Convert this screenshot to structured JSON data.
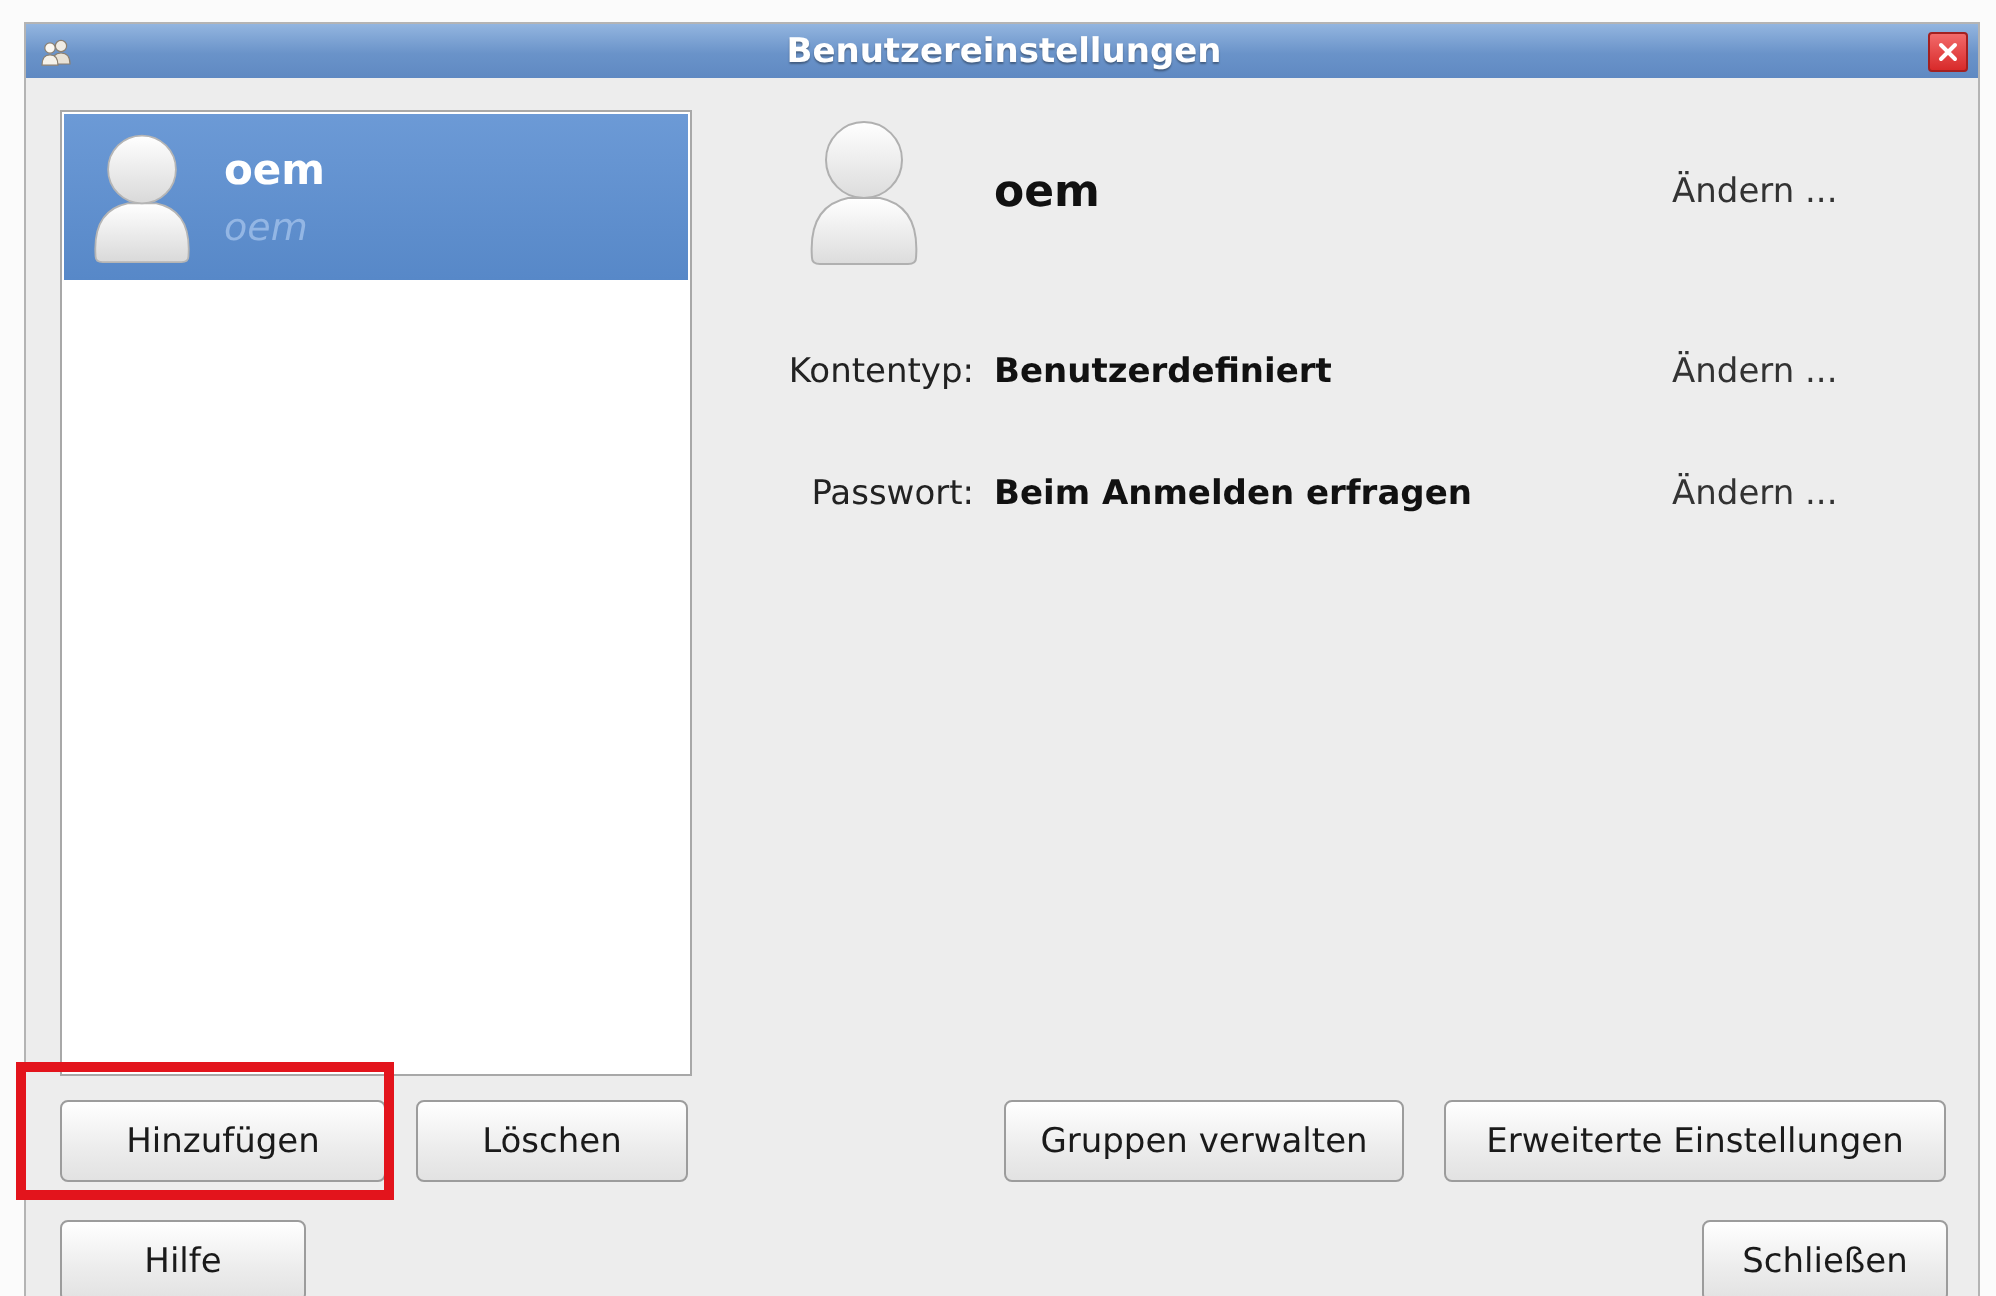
{
  "window": {
    "title": "Benutzereinstellungen"
  },
  "users": [
    {
      "name": "oem",
      "login": "oem",
      "selected": true
    }
  ],
  "details": {
    "name": "oem",
    "change": "Ändern ...",
    "fields": [
      {
        "label": "Kontentyp:",
        "value": "Benutzerdefiniert",
        "change": "Ändern ..."
      },
      {
        "label": "Passwort:",
        "value": "Beim Anmelden erfragen",
        "change": "Ändern ..."
      }
    ]
  },
  "list_buttons": [
    {
      "label": "Hinzufügen",
      "highlighted": true
    },
    {
      "label": "Löschen",
      "highlighted": false
    }
  ],
  "action_buttons": [
    {
      "label": "Gruppen verwalten"
    },
    {
      "label": "Erweiterte Einstellungen"
    }
  ],
  "help_button": {
    "label": "Hilfe"
  },
  "close_button": {
    "label": "Schließen"
  }
}
